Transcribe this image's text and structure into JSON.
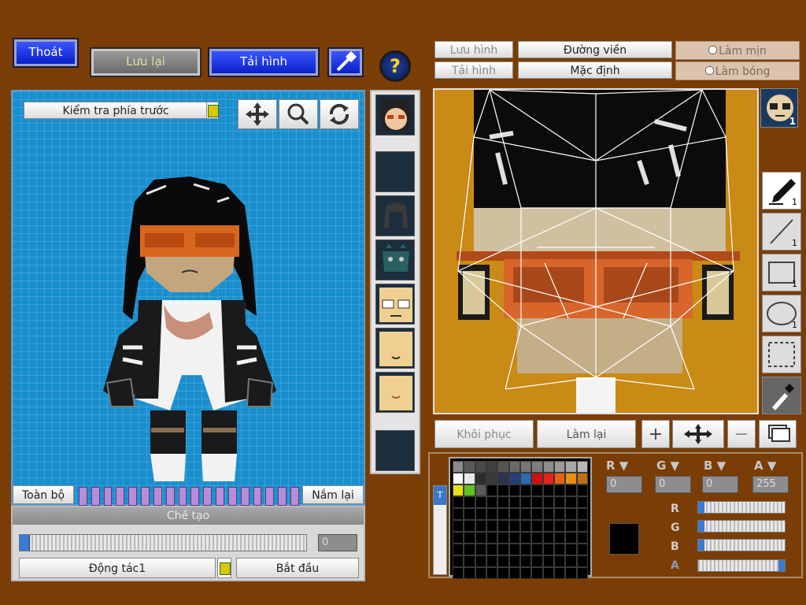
{
  "toolbar": {
    "exit_label": "Thoát",
    "save_label": "Lưu lại",
    "load_label": "Tải hình",
    "help_symbol": "?"
  },
  "viewport": {
    "view_select_value": "Kiểm tra phía trước",
    "tool_move": "move",
    "tool_zoom": "zoom",
    "tool_rotate": "rotate",
    "all_label": "Toàn bộ",
    "hold_label": "Nắm lại"
  },
  "create_panel": {
    "title": "Chế tạo",
    "progress_value": "0",
    "action_select_value": "Động tác1",
    "start_label": "Bắt đầu"
  },
  "editor_top": {
    "save_image_label": "Lưu hình",
    "load_image_label": "Tải hình",
    "outline_label": "Đường viền",
    "default_label": "Mặc định",
    "smooth_label": "Làm mịn",
    "gloss_label": "Làm bóng"
  },
  "editor_bottom": {
    "restore_label": "Khôi phục",
    "redo_label": "Làm lại",
    "plus_symbol": "+",
    "minus_symbol": "−"
  },
  "tools": {
    "pen_count": "1",
    "line_count": "1",
    "rect_count": "1",
    "ellipse_count": "1",
    "face_count": "1"
  },
  "color": {
    "r_value": "0",
    "g_value": "0",
    "b_value": "0",
    "a_value": "255",
    "current_color": "#000000",
    "r_letter": "R",
    "g_letter": "G",
    "b_letter": "B",
    "a_letter": "A",
    "palette_row1": [
      "#8a8a8a",
      "#5a5a5a",
      "#4a4a4a",
      "#404040",
      "#555555",
      "#6a6a6a",
      "#777777",
      "#7d7d7d",
      "#8c8c8c",
      "#9a9a9a",
      "#a8a8a8",
      "#b8b8b8"
    ],
    "palette_row2": [
      "#ffffff",
      "#e8e8e8",
      "#2d2d2d",
      "#3a3a3a",
      "#2a3550",
      "#23407a",
      "#2a6ab0",
      "#d01010",
      "#e8201a",
      "#e86010",
      "#e89010",
      "#c07010"
    ],
    "palette_row3": [
      "#e8e010",
      "#60c020",
      "#5a5a5a"
    ]
  },
  "parts": {
    "items": [
      "face-thumb",
      "empty",
      "hair",
      "armor",
      "face-glasses",
      "face-plain",
      "face-smile",
      "empty-bottom"
    ]
  }
}
